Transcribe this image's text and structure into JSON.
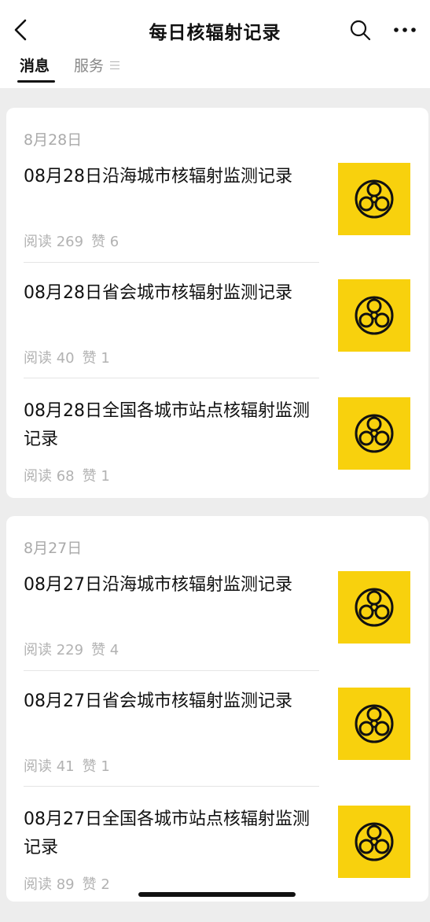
{
  "header": {
    "title": "每日核辐射记录",
    "back_icon": "chevron-left-icon",
    "search_icon": "search-icon",
    "more_icon": "more-icon"
  },
  "tabs": [
    {
      "label": "消息",
      "active": true
    },
    {
      "label": "服务",
      "active": false,
      "icon": "list-icon"
    }
  ],
  "groups": [
    {
      "date": "8月28日",
      "items": [
        {
          "title": "08月28日沿海城市核辐射监测记录",
          "reads": "阅读 269",
          "likes": "赞 6"
        },
        {
          "title": "08月28日省会城市核辐射监测记录",
          "reads": "阅读 40",
          "likes": "赞 1"
        },
        {
          "title": "08月28日全国各城市站点核辐射监测记录",
          "reads": "阅读 68",
          "likes": "赞 1"
        }
      ]
    },
    {
      "date": "8月27日",
      "items": [
        {
          "title": "08月27日沿海城市核辐射监测记录",
          "reads": "阅读 229",
          "likes": "赞 4"
        },
        {
          "title": "08月27日省会城市核辐射监测记录",
          "reads": "阅读 41",
          "likes": "赞 1"
        },
        {
          "title": "08月27日全国各城市站点核辐射监测记录",
          "reads": "阅读 89",
          "likes": "赞 2"
        }
      ]
    }
  ],
  "colors": {
    "thumb_background": "#f8d10d",
    "page_background": "#ededed"
  },
  "thumbnail_icon": "biohazard-icon"
}
